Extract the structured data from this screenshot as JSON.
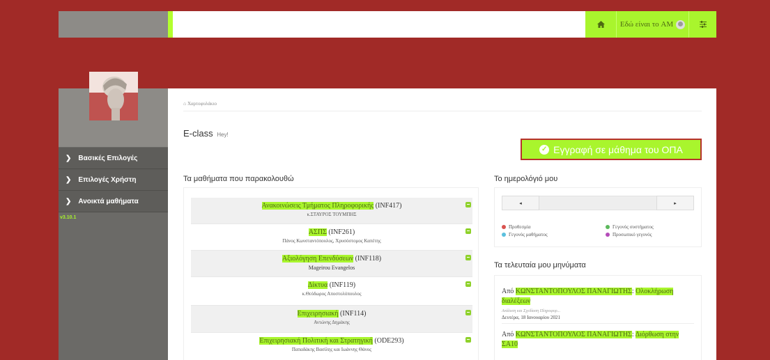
{
  "topbar": {
    "user_label": "Εδώ είναι το AM",
    "icons": [
      "home-icon",
      "user-avatar-icon",
      "sliders-icon"
    ]
  },
  "sidebar": {
    "items": [
      {
        "label": "Βασικές Επιλογές"
      },
      {
        "label": "Επιλογές Χρήστη"
      },
      {
        "label": "Ανοικτά μαθήματα"
      }
    ],
    "version": "v3.10.1"
  },
  "main": {
    "breadcrumb": "Χαρτοφυλάκιο",
    "title": "E-class",
    "title_small": "Hey!",
    "enroll_button": "Εγγραφή σε μάθημα του ΟΠΑ",
    "courses_heading": "Τα μαθήματα που παρακολουθώ",
    "calendar_heading": "Το ημερολόγιό μου",
    "messages_heading": "Τα τελευταία μου μηνύματα"
  },
  "courses": [
    {
      "name": "Ανακοινώσεις Τμήματος Πληροφορικής",
      "code": "(INF417)",
      "instructor": "κ.ΣΤΑΥΡΟΣ ΤΟΥΜΠΗΣ"
    },
    {
      "name": "ΑΣΠΣ",
      "code": "(INF261)",
      "instructor": "Πάνος Κωνσταντόπουλος, Χρυσόστομος Καπέτης"
    },
    {
      "name": "Αξιολόγηση Επενδύσεων",
      "code": "(INF118)",
      "instructor": "Mageirou Evangelos"
    },
    {
      "name": "Δίκτυα",
      "code": "(INF119)",
      "instructor": "κ.Θεόδωρος Αποστολόπουλος"
    },
    {
      "name": "Επιχειρησιακή",
      "code": "(INF114)",
      "instructor": "Αντώνης Δημάκης"
    },
    {
      "name": "Επιχειρησιακή Πολιτική και Στρατηγική",
      "code": "(ODE293)",
      "instructor": "Παπαδάκης Βασίλης και Ιωάννης Θάνος"
    }
  ],
  "calendar": {
    "prev_glyph": "◂",
    "next_glyph": "▸",
    "legend": [
      {
        "label": "Προθεσμία",
        "color": "#d9534f"
      },
      {
        "label": "Γεγονός συστήματος",
        "color": "#5cb85c"
      },
      {
        "label": "Γεγονός μαθήματος",
        "color": "#5bc0de"
      },
      {
        "label": "Προσωπικό γεγονός",
        "color": "#b44bb9"
      }
    ]
  },
  "messages": [
    {
      "from_prefix": "Από",
      "sender": "ΚΩΝΣΤΑΝΤΟΠΟΥΛΟΣ ΠΑΝΑΓΙΩΤΗΣ",
      "subject": "Ολοκλήρωση διαλέξεων",
      "course": "Ανάλυση και Σχεδίαση Πληροφορ...",
      "date": "Δευτέρα, 18 Ιανουαρίου 2021"
    },
    {
      "from_prefix": "Από",
      "sender": "ΚΩΝΣΤΑΝΤΟΠΟΥΛΟΣ ΠΑΝΑΓΙΩΤΗΣ",
      "subject": "Διόρθωση στην ΣΑ10"
    }
  ],
  "colors": {
    "background": "#a12a27",
    "accent": "#a9f52d",
    "sidebar": "#6b6a67"
  }
}
